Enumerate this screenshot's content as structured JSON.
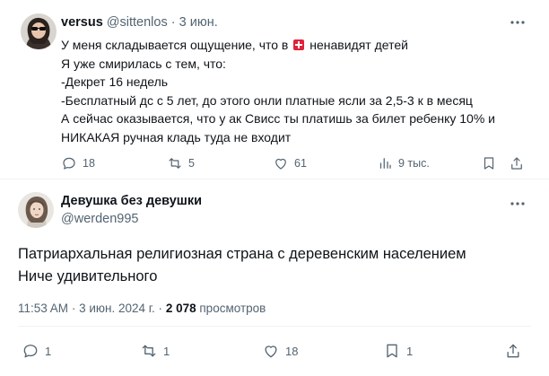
{
  "tweet1": {
    "name": "versus",
    "handle": "@sittenlos",
    "separator": "·",
    "date": "3 июн.",
    "lines": {
      "l1a": "У меня складывается ощущение, что в",
      "l1b": "ненавидят детей",
      "l2": "Я уже смирилась с тем, что:",
      "l3": "-Декрет 16 недель",
      "l4": "-Бесплатный дс с 5 лет, до этого онли платные ясли за 2,5-3 к в месяц",
      "l5": "А сейчас оказывается, что у ак Свисс ты платишь за билет ребенку 10% и",
      "l6": "НИКАКАЯ ручная кладь туда не входит"
    },
    "flag_icon": "swiss-flag-emoji",
    "actions": {
      "replies": "18",
      "reposts": "5",
      "likes": "61",
      "views": "9 тыс."
    }
  },
  "tweet2": {
    "name": "Девушка без девушки",
    "handle": "@werden995",
    "lines": {
      "l1": "Патриархальная религиозная страна с деревенским населением",
      "l2": "Ниче удивительного"
    },
    "meta": {
      "time": "11:53 AM",
      "separator": "·",
      "date": "3 июн. 2024 г.",
      "views_count": "2 078",
      "views_label": "просмотров"
    },
    "actions": {
      "replies": "1",
      "reposts": "1",
      "likes": "18",
      "bookmarks": "1"
    }
  },
  "colors": {
    "text": "#0f1419",
    "muted": "#536471",
    "border": "#eff3f4",
    "flag": "#e0223a"
  }
}
